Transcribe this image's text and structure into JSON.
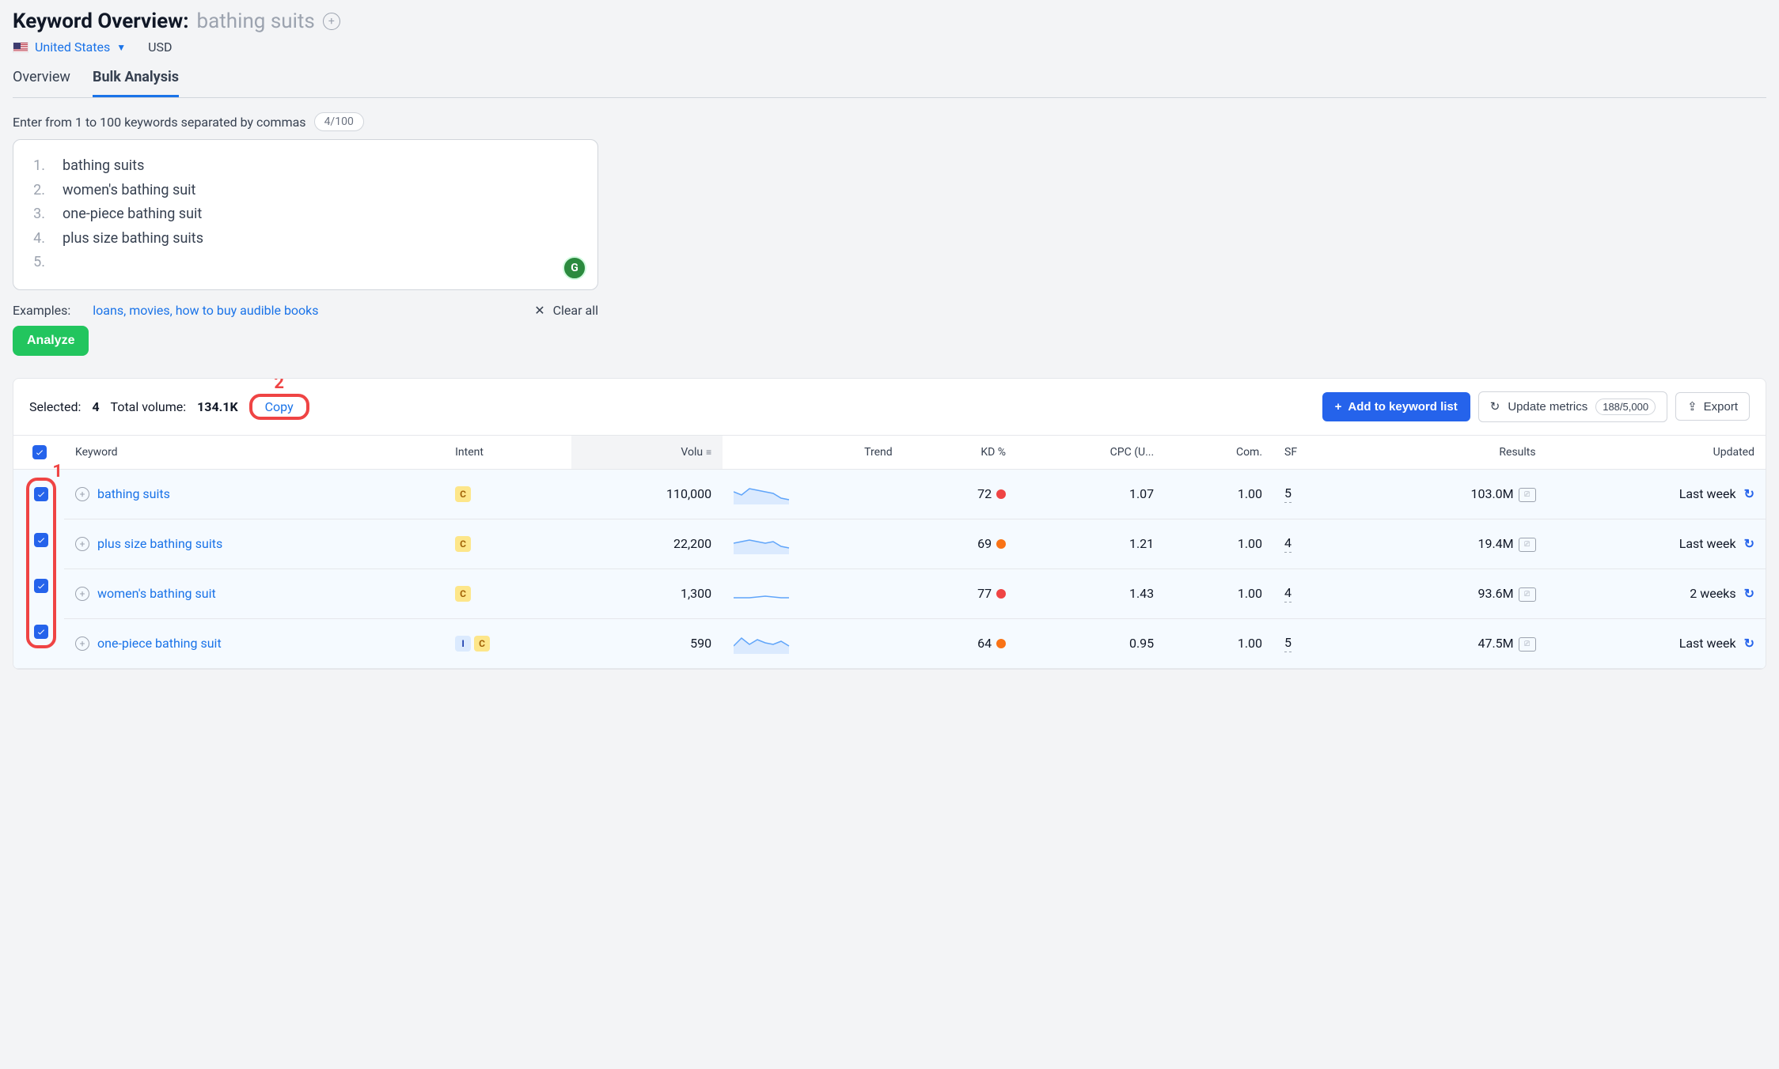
{
  "header": {
    "title_prefix": "Keyword Overview:",
    "keyword": "bathing suits",
    "country": "United States",
    "currency": "USD"
  },
  "tabs": {
    "overview": "Overview",
    "bulk": "Bulk Analysis"
  },
  "input": {
    "prompt": "Enter from 1 to 100 keywords separated by commas",
    "counter": "4/100",
    "lines": [
      "bathing suits",
      "women's bathing suit",
      "one-piece bathing suit",
      "plus size bathing suits"
    ]
  },
  "examples": {
    "label": "Examples:",
    "links": "loans, movies, how to buy audible books",
    "clear": "Clear all"
  },
  "analyze": "Analyze",
  "callouts": {
    "one": "1",
    "two": "2"
  },
  "toolbar": {
    "selected_label": "Selected:",
    "selected": "4",
    "totalvol_label": "Total volume:",
    "totalvol": "134.1K",
    "copy": "Copy",
    "add": "Add to keyword list",
    "update": "Update metrics",
    "quota": "188/5,000",
    "export": "Export"
  },
  "columns": {
    "keyword": "Keyword",
    "intent": "Intent",
    "volume": "Volu",
    "trend": "Trend",
    "kd": "KD %",
    "cpc": "CPC (U...",
    "com": "Com.",
    "sf": "SF",
    "results": "Results",
    "updated": "Updated"
  },
  "rows": [
    {
      "keyword": "bathing suits",
      "intents": [
        "C"
      ],
      "volume": "110,000",
      "kd": "72",
      "kdColor": "red",
      "cpc": "1.07",
      "com": "1.00",
      "sf": "5",
      "results": "103.0M",
      "updated": "Last week",
      "spark": "0,10 10,14 20,6 30,8 40,10 50,12 60,18 70,20"
    },
    {
      "keyword": "plus size bathing suits",
      "intents": [
        "C"
      ],
      "volume": "22,200",
      "kd": "69",
      "kdColor": "orange",
      "cpc": "1.21",
      "com": "1.00",
      "sf": "4",
      "results": "19.4M",
      "updated": "Last week",
      "spark": "0,12 10,10 20,8 30,10 40,12 50,10 60,16 70,18"
    },
    {
      "keyword": "women's bathing suit",
      "intents": [
        "C"
      ],
      "volume": "1,300",
      "kd": "77",
      "kdColor": "red",
      "cpc": "1.43",
      "com": "1.00",
      "sf": "4",
      "results": "93.6M",
      "updated": "2 weeks",
      "spark": "0,18 20,18 40,16 60,18 70,18"
    },
    {
      "keyword": "one-piece bathing suit",
      "intents": [
        "I",
        "C"
      ],
      "volume": "590",
      "kd": "64",
      "kdColor": "orange",
      "cpc": "0.95",
      "com": "1.00",
      "sf": "5",
      "results": "47.5M",
      "updated": "Last week",
      "spark": "0,16 10,6 20,14 30,8 40,12 50,14 60,10 70,16"
    }
  ]
}
